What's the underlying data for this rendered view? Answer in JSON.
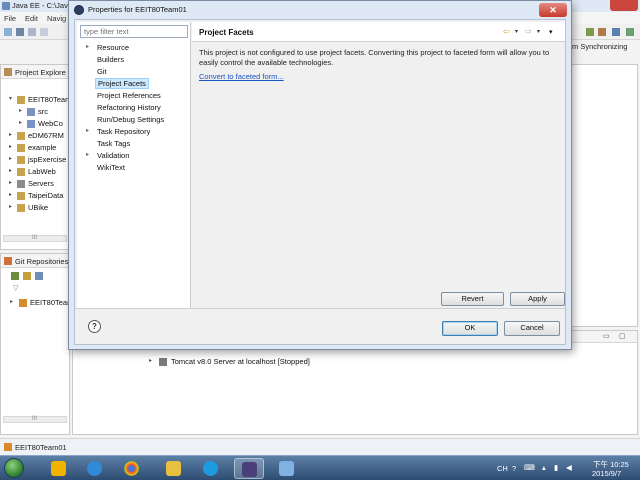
{
  "eclipse": {
    "window_title": "Java EE - C:\\Jav",
    "menu": [
      "File",
      "Edit",
      "Navig"
    ],
    "perspective_label": "m Synchronizing",
    "project_explorer": {
      "title": "Project Explore",
      "items": [
        {
          "label": "EEIT80Team",
          "level": 0,
          "arrow": "▾"
        },
        {
          "label": "src",
          "level": 1,
          "arrow": "▸"
        },
        {
          "label": "WebCo",
          "level": 1,
          "arrow": "▸"
        },
        {
          "label": "eDM67RM",
          "level": 0,
          "arrow": "▸"
        },
        {
          "label": "example",
          "level": 0,
          "arrow": "▸"
        },
        {
          "label": "jspExercise",
          "level": 0,
          "arrow": "▸"
        },
        {
          "label": "LabWeb",
          "level": 0,
          "arrow": "▸"
        },
        {
          "label": "Servers",
          "level": 0,
          "arrow": "▸"
        },
        {
          "label": "TaipeiData",
          "level": 0,
          "arrow": "▸"
        },
        {
          "label": "UBike",
          "level": 0,
          "arrow": "▸"
        }
      ],
      "scroll_label": "III"
    },
    "git_repositories": {
      "title": "Git Repositories",
      "items": [
        {
          "label": "EEIT80Team",
          "arrow": "▸"
        }
      ],
      "scroll_label": "III"
    },
    "servers": {
      "items": [
        {
          "label": "Tomcat v8.0 Server at localhost  [Stopped]",
          "arrow": "▸"
        }
      ]
    },
    "status_bar": "EEIT80Team01"
  },
  "dialog": {
    "title": "Properties for EEIT80Team01",
    "close": "✕",
    "filter_placeholder": "type filter text",
    "nav": [
      {
        "label": "Resource",
        "arrow": "▸",
        "selected": false
      },
      {
        "label": "Builders",
        "arrow": "",
        "selected": false
      },
      {
        "label": "Git",
        "arrow": "",
        "selected": false
      },
      {
        "label": "Project Facets",
        "arrow": "",
        "selected": true
      },
      {
        "label": "Project References",
        "arrow": "",
        "selected": false
      },
      {
        "label": "Refactoring History",
        "arrow": "",
        "selected": false
      },
      {
        "label": "Run/Debug Settings",
        "arrow": "",
        "selected": false
      },
      {
        "label": "Task Repository",
        "arrow": "▸",
        "selected": false
      },
      {
        "label": "Task Tags",
        "arrow": "",
        "selected": false
      },
      {
        "label": "Validation",
        "arrow": "▸",
        "selected": false
      },
      {
        "label": "WikiText",
        "arrow": "",
        "selected": false
      }
    ],
    "page_title": "Project Facets",
    "message": "This project is not configured to use project facets. Converting this project to faceted form will allow you to easily control the available technologies.",
    "convert_link": "Convert to faceted form...",
    "revert_label": "Revert",
    "apply_label": "Apply",
    "ok_label": "OK",
    "cancel_label": "Cancel",
    "help": "?"
  },
  "taskbar": {
    "lang": "CH",
    "time": "下午 10:25",
    "date": "2015/9/7"
  },
  "colors": {
    "dialog_frame": "#dfe9f5",
    "selection": "#cde8ff",
    "link": "#1a56c4",
    "taskbar": "#2e4c72"
  }
}
